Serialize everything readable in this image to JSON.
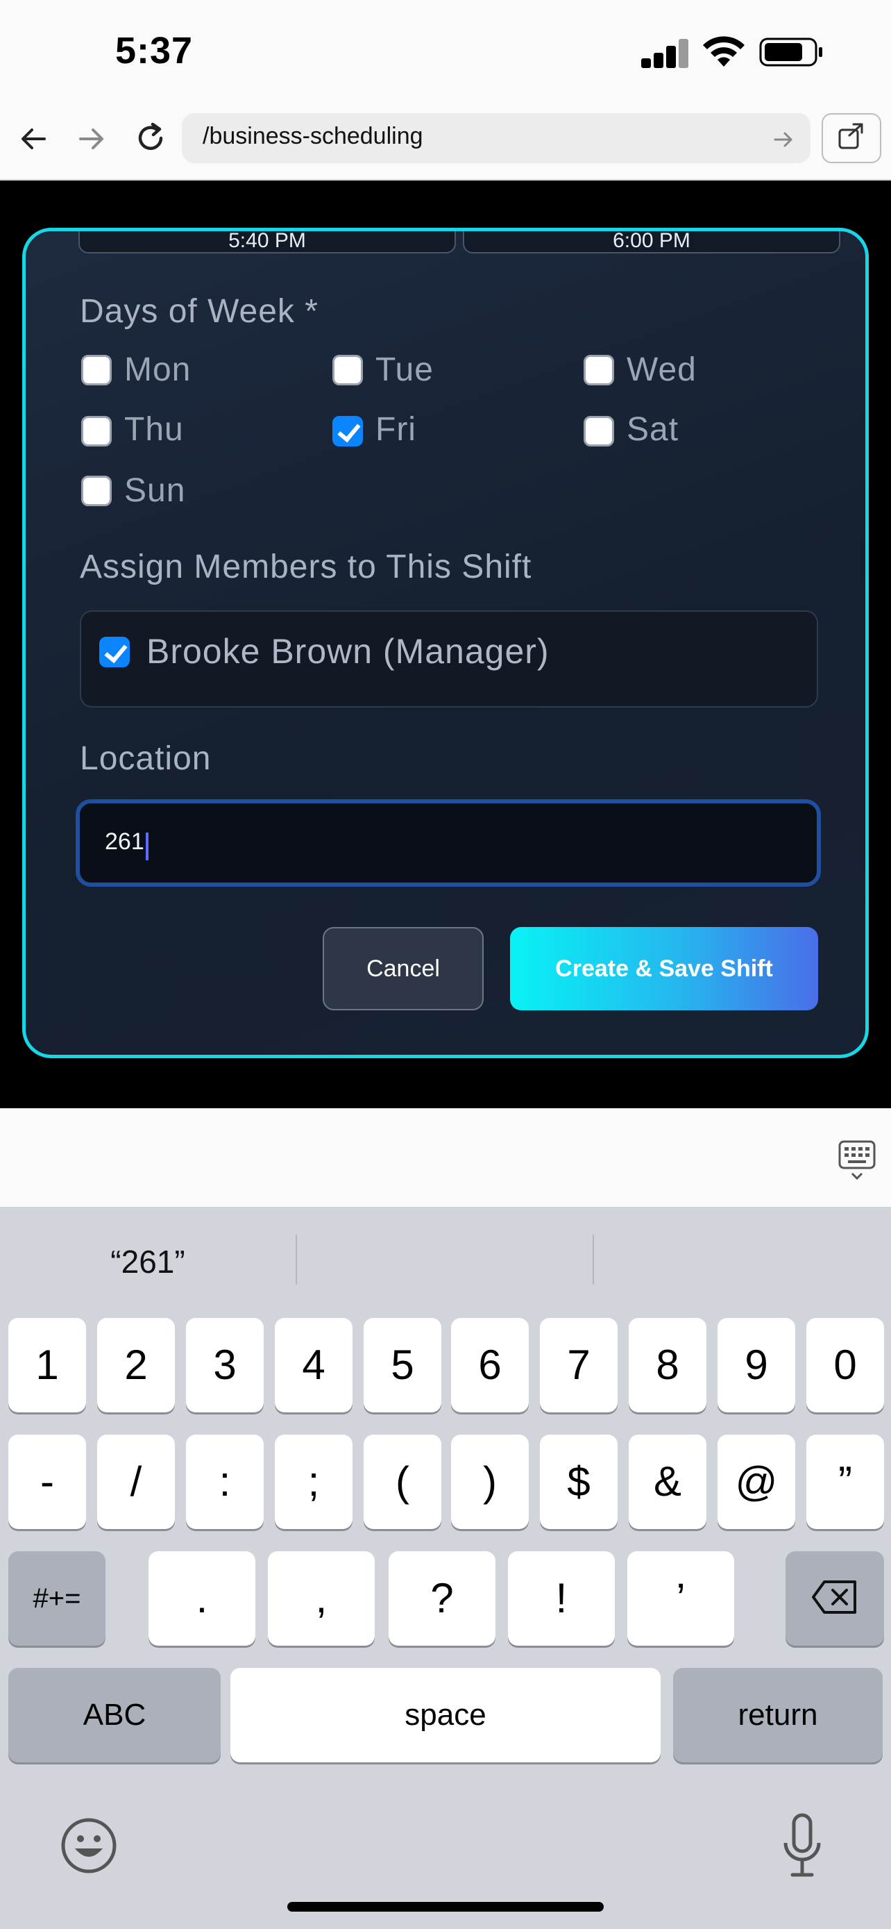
{
  "status_bar": {
    "time": "5:37"
  },
  "browser": {
    "url": "/business-scheduling"
  },
  "form": {
    "start_time": "5:40 PM",
    "end_time": "6:00 PM",
    "days_label": "Days of Week *",
    "days": [
      {
        "label": "Mon",
        "checked": false
      },
      {
        "label": "Tue",
        "checked": false
      },
      {
        "label": "Wed",
        "checked": false
      },
      {
        "label": "Thu",
        "checked": false
      },
      {
        "label": "Fri",
        "checked": true
      },
      {
        "label": "Sat",
        "checked": false
      },
      {
        "label": "Sun",
        "checked": false
      }
    ],
    "members_label": "Assign Members to This Shift",
    "member": {
      "label": "Brooke Brown (Manager)",
      "checked": true
    },
    "location_label": "Location",
    "location_value": "261",
    "cancel_label": "Cancel",
    "save_label": "Create & Save Shift"
  },
  "keyboard": {
    "suggestions": [
      "“261”",
      "",
      ""
    ],
    "row1": [
      "1",
      "2",
      "3",
      "4",
      "5",
      "6",
      "7",
      "8",
      "9",
      "0"
    ],
    "row2": [
      "-",
      "/",
      ":",
      ";",
      "(",
      ")",
      "$",
      "&",
      "@",
      "”"
    ],
    "row3": [
      ".",
      ",",
      "?",
      "!",
      "’"
    ],
    "symbols_label": "#+=",
    "abc_label": "ABC",
    "space_label": "space",
    "return_label": "return"
  },
  "colors": {
    "accent_border": "#19d6e6",
    "checkbox_on": "#0a84ff",
    "button_gradient_start": "#08f2f5",
    "button_gradient_end": "#4a6ee8"
  }
}
